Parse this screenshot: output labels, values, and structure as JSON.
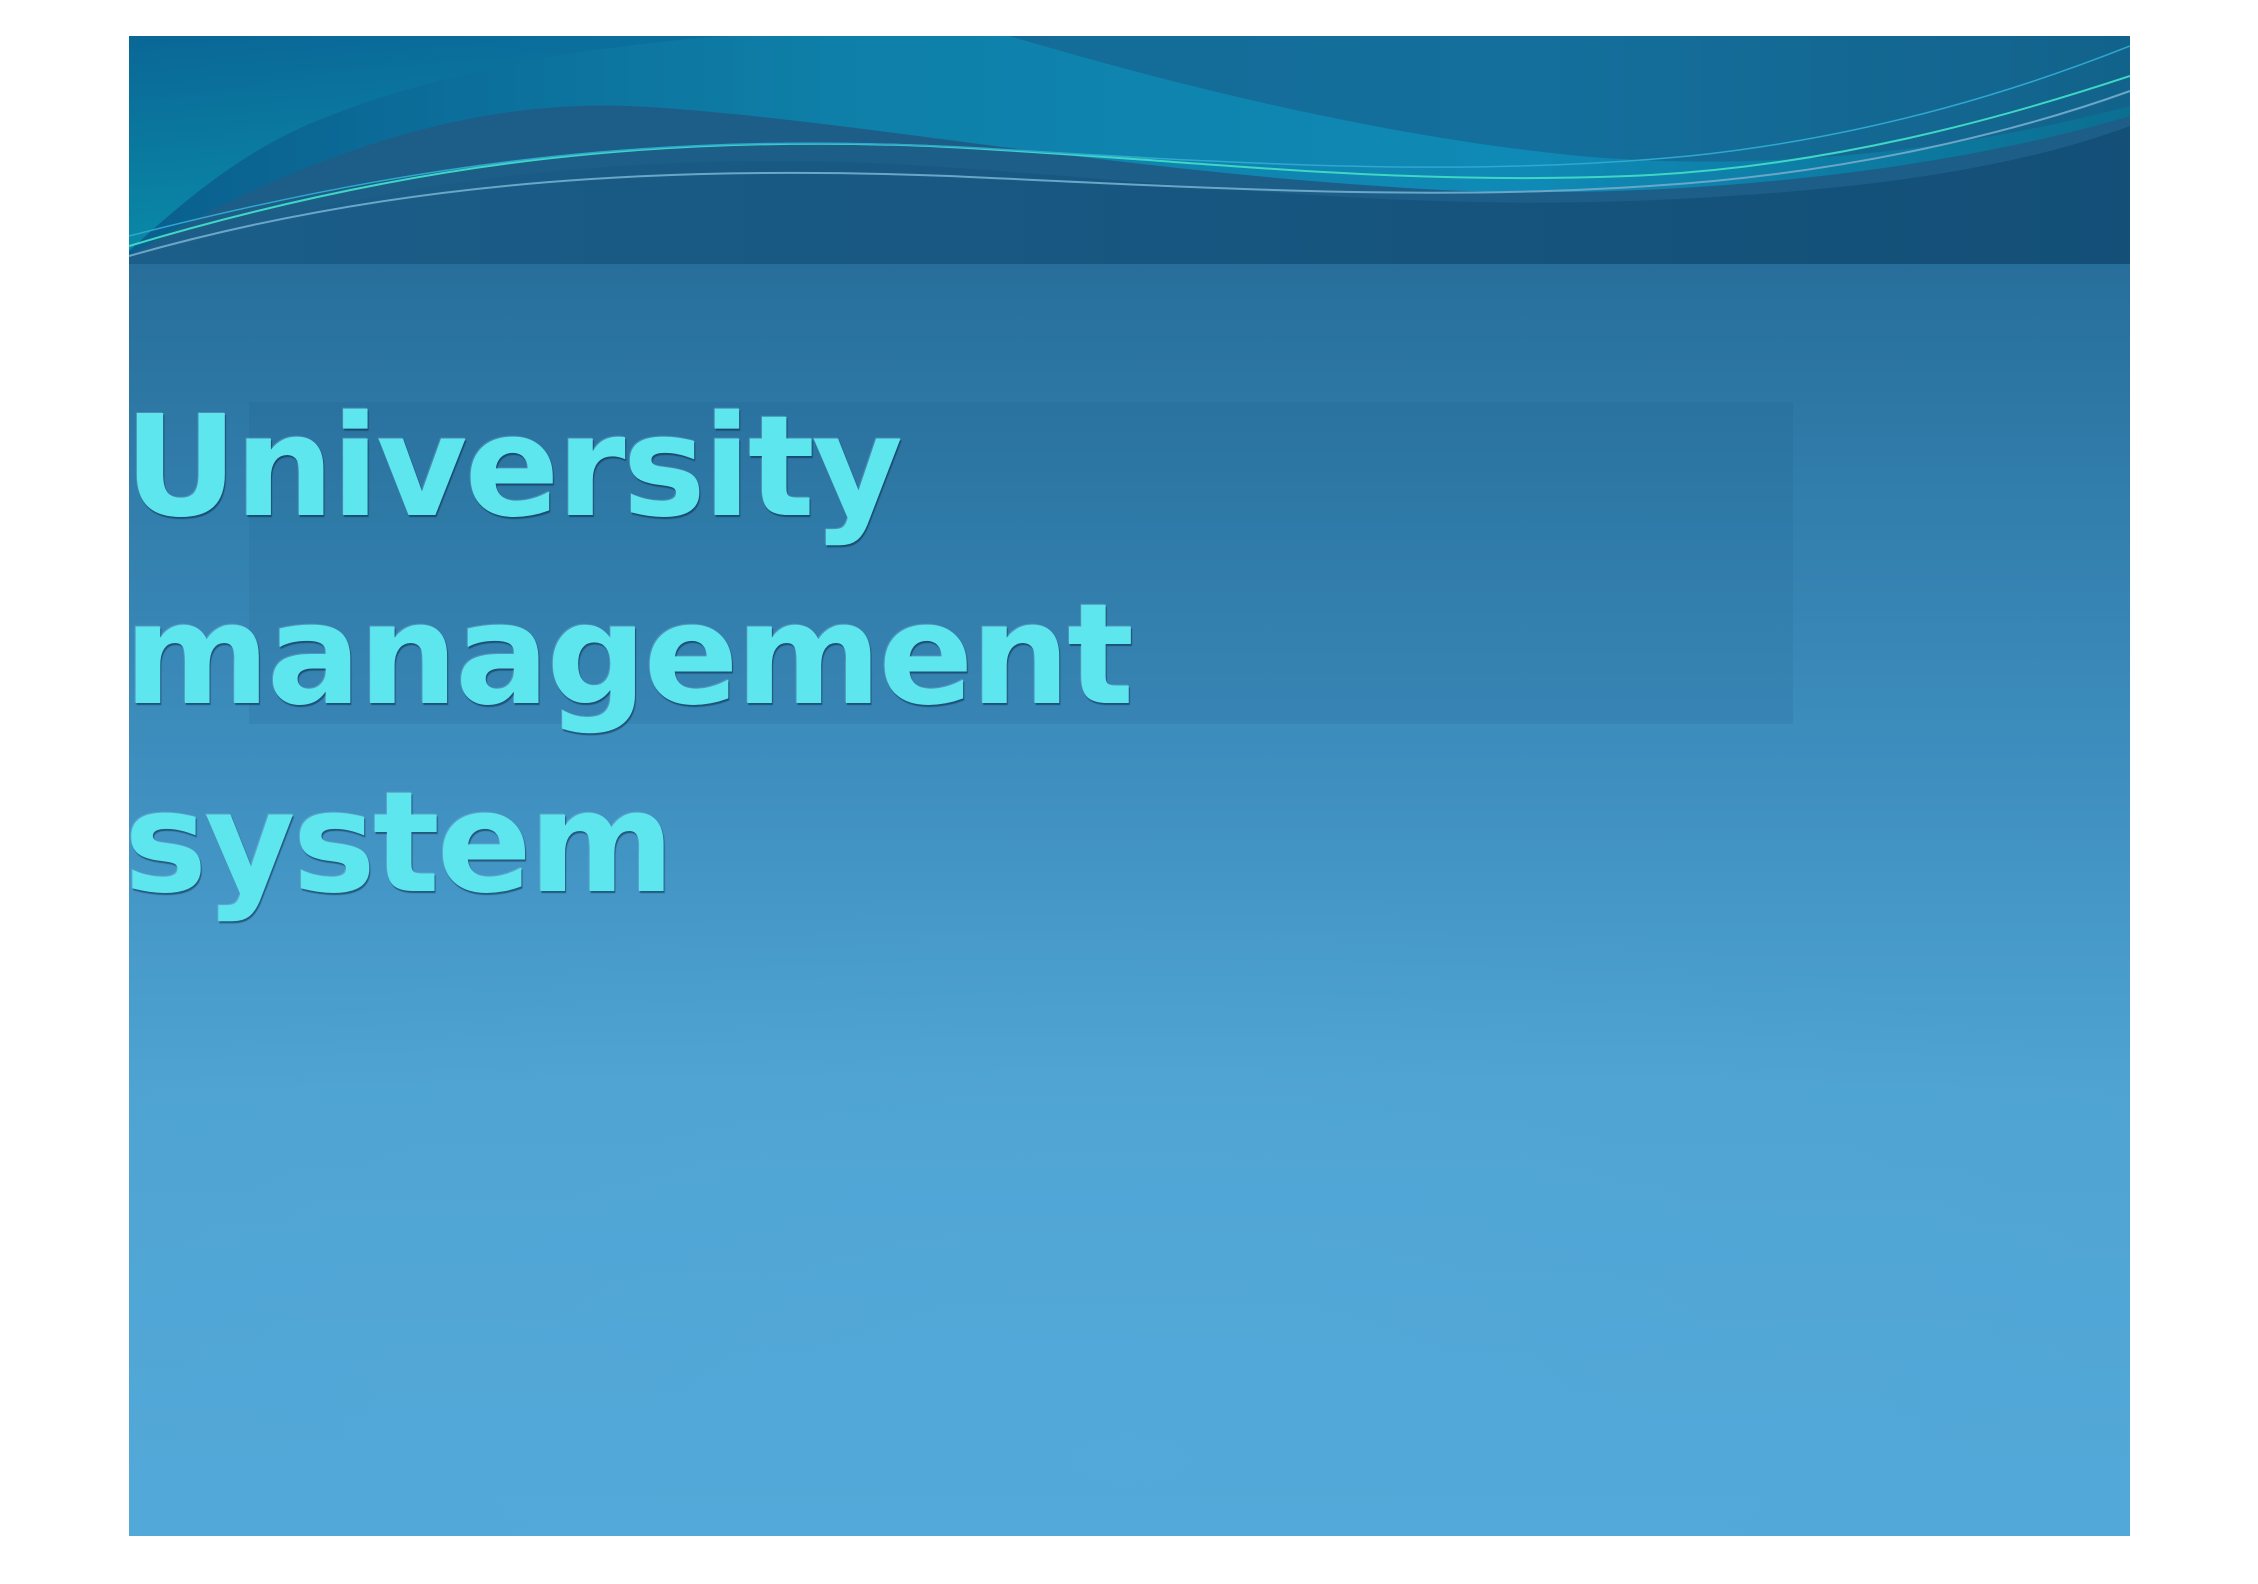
{
  "slide": {
    "title": "University management system"
  },
  "colors": {
    "background_top": "#1f5f8c",
    "background_bottom": "#52a8d8",
    "title_text": "#5ee6ee",
    "wave_teal": "#0a8fb0",
    "wave_dark": "#0f4a72"
  }
}
